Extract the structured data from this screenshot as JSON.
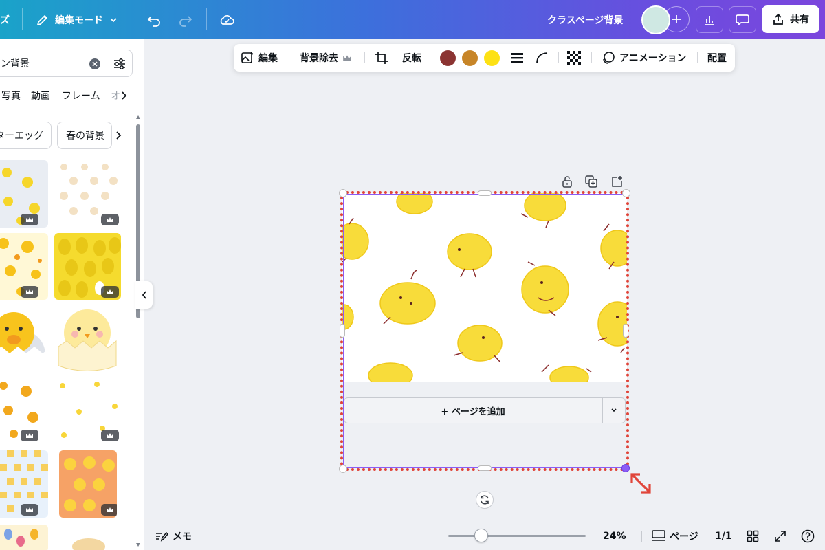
{
  "topbar": {
    "left_cut_label": "ズ",
    "edit_mode_label": "編集モード",
    "title": "クラスページ背景",
    "share_label": "共有",
    "gradient": [
      "#1aa3c9",
      "#7b46dd"
    ]
  },
  "sidebar": {
    "search_value": "ン背景",
    "tabs": [
      "写真",
      "動画",
      "フレーム",
      "オ"
    ],
    "chips": [
      "ターエッグ",
      "春の背景"
    ],
    "premium_icon": "crown-icon"
  },
  "context_toolbar": {
    "edit_label": "編集",
    "bg_remove_label": "背景除去",
    "flip_label": "反転",
    "colors": [
      "#8b3432",
      "#c78528",
      "#fde114"
    ],
    "animation_label": "アニメーション",
    "position_label": "配置"
  },
  "canvas": {
    "add_page_label": "+ ページを追加",
    "selection_color": "#e0453a"
  },
  "footer": {
    "notes_label": "メモ",
    "zoom_label": "24%",
    "zoom_value": 0.24,
    "pages_label": "ページ",
    "page_count": "1/1"
  }
}
